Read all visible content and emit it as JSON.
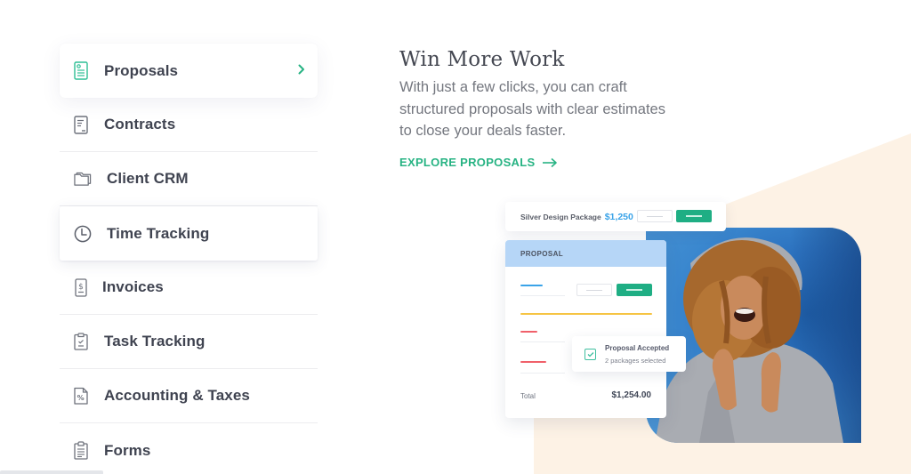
{
  "sidebar": {
    "items": [
      {
        "label": "Proposals",
        "icon": "proposal-doc-icon",
        "active": true
      },
      {
        "label": "Contracts",
        "icon": "contract-doc-icon"
      },
      {
        "label": "Client CRM",
        "icon": "folder-icon"
      },
      {
        "label": "Time Tracking",
        "icon": "clock-icon"
      },
      {
        "label": "Invoices",
        "icon": "invoice-dollar-icon"
      },
      {
        "label": "Task Tracking",
        "icon": "clipboard-check-icon"
      },
      {
        "label": "Accounting & Taxes",
        "icon": "percent-doc-icon"
      },
      {
        "label": "Forms",
        "icon": "clipboard-list-icon"
      }
    ]
  },
  "feature": {
    "title": "Win More Work",
    "description": "With just a few clicks, you can craft structured proposals with clear estimates to close your deals faster.",
    "cta": "EXPLORE PROPOSALS"
  },
  "mockup": {
    "package_name": "Silver Design Package",
    "package_price": "$1,250",
    "proposal_header": "PROPOSAL",
    "total_label": "Total",
    "total_value": "$1,254.00",
    "accepted_title": "Proposal Accepted",
    "accepted_subtitle": "2 packages selected"
  },
  "colors": {
    "accent_green": "#27b383",
    "price_blue": "#3aa3e8",
    "proposal_header_bg": "#b6d6f7",
    "beige_bg": "#fdf3e6"
  }
}
